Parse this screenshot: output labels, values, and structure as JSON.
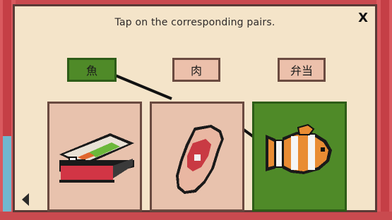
{
  "instruction": "Tap on the corresponding pairs.",
  "close_label": "X",
  "words": [
    {
      "label": "魚",
      "selected": true
    },
    {
      "label": "肉",
      "selected": false
    },
    {
      "label": "弁当",
      "selected": false
    }
  ],
  "cards": [
    {
      "item": "bento",
      "icon": "bento-box-icon",
      "selected": false
    },
    {
      "item": "meat",
      "icon": "steak-icon",
      "selected": false
    },
    {
      "item": "fish",
      "icon": "clownfish-icon",
      "selected": true
    }
  ],
  "colors": {
    "selected": "#4f8a28",
    "tile": "#ecc0ab",
    "panel": "#f4e4c9",
    "frame": "#c94a4f"
  }
}
